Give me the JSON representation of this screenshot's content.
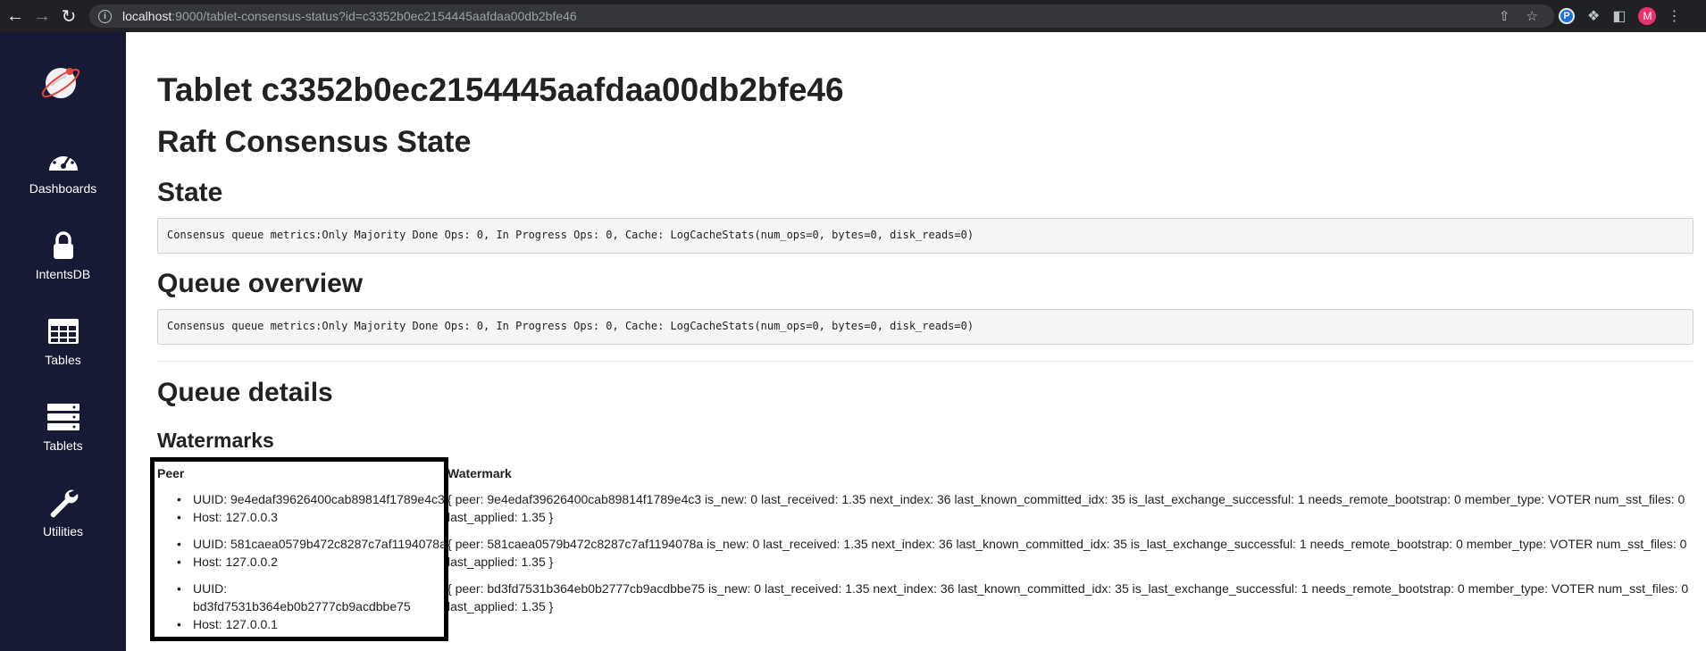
{
  "browser": {
    "url_host": "localhost",
    "url_rest": ":9000/tablet-consensus-status?id=c3352b0ec2154445aafdaa00db2bfe46",
    "avatar_letter": "M",
    "ext_letter": "P"
  },
  "sidebar": {
    "items": [
      {
        "label": "Dashboards",
        "icon": "gauge-icon"
      },
      {
        "label": "IntentsDB",
        "icon": "lock-icon"
      },
      {
        "label": "Tables",
        "icon": "table-icon"
      },
      {
        "label": "Tablets",
        "icon": "server-icon"
      },
      {
        "label": "Utilities",
        "icon": "wrench-icon"
      }
    ]
  },
  "page": {
    "title": "Tablet c3352b0ec2154445aafdaa00db2bfe46",
    "raft_heading": "Raft Consensus State",
    "state_heading": "State",
    "state_text": "Consensus queue metrics:Only Majority Done Ops: 0, In Progress Ops: 0, Cache: LogCacheStats(num_ops=0, bytes=0, disk_reads=0)",
    "queue_overview_heading": "Queue overview",
    "queue_overview_text": "Consensus queue metrics:Only Majority Done Ops: 0, In Progress Ops: 0, Cache: LogCacheStats(num_ops=0, bytes=0, disk_reads=0)",
    "queue_details_heading": "Queue details",
    "watermarks_heading": "Watermarks"
  },
  "watermarks": {
    "col_peer": "Peer",
    "col_watermark": "Watermark",
    "rows": [
      {
        "uuid": "UUID: 9e4edaf39626400cab89814f1789e4c3",
        "host": "Host: 127.0.0.3",
        "watermark_line1": "{ peer: 9e4edaf39626400cab89814f1789e4c3 is_new: 0 last_received: 1.35 next_index: 36 last_known_committed_idx: 35 is_last_exchange_successful: 1 needs_remote_bootstrap: 0 member_type: VOTER num_sst_files: 0",
        "watermark_line2": "last_applied: 1.35 }"
      },
      {
        "uuid": "UUID: 581caea0579b472c8287c7af1194078a",
        "host": "Host: 127.0.0.2",
        "watermark_line1": "{ peer: 581caea0579b472c8287c7af1194078a is_new: 0 last_received: 1.35 next_index: 36 last_known_committed_idx: 35 is_last_exchange_successful: 1 needs_remote_bootstrap: 0 member_type: VOTER num_sst_files: 0",
        "watermark_line2": "last_applied: 1.35 }"
      },
      {
        "uuid_label": "UUID:",
        "uuid_value": "bd3fd7531b364eb0b2777cb9acdbbe75",
        "host": "Host: 127.0.0.1",
        "watermark_line1": "{ peer: bd3fd7531b364eb0b2777cb9acdbbe75 is_new: 0 last_received: 1.35 next_index: 36 last_known_committed_idx: 35 is_last_exchange_successful: 1 needs_remote_bootstrap: 0 member_type: VOTER num_sst_files: 0",
        "watermark_line2": "last_applied: 1.35 }"
      }
    ]
  },
  "colors": {
    "sidebar_bg": "#161a35",
    "chrome_bg": "#202124",
    "highlight_border": "#000000"
  }
}
